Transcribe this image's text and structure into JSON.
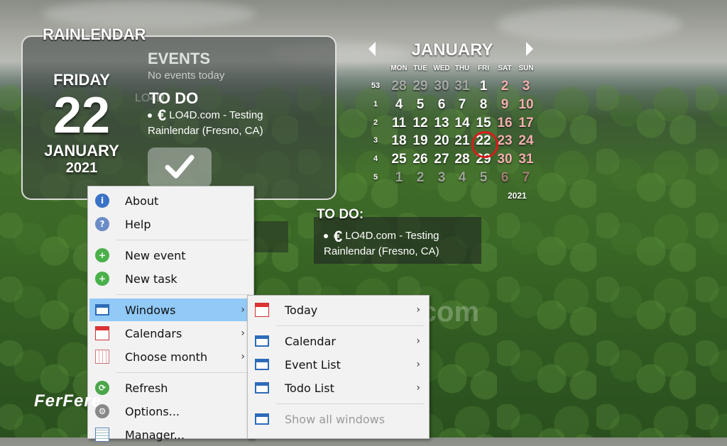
{
  "widget": {
    "title": "RAINLENDAR",
    "weekday": "FRIDAY",
    "day": "22",
    "month": "JANUARY",
    "year": "2021",
    "events_heading": "EVENTS",
    "events_empty": "No events today",
    "todo_heading": "TO DO",
    "todo_item": "LO4D.com - Testing Rainlendar (Fresno, CA)",
    "currency_glyph": "€",
    "watermark": "LO4D"
  },
  "calendar": {
    "month": "JANUARY",
    "year": "2021",
    "weekdays": [
      "MON",
      "TUE",
      "WED",
      "THU",
      "FRI",
      "SAT",
      "SUN"
    ],
    "weeks": [
      {
        "wk": "53",
        "days": [
          "28",
          "29",
          "30",
          "31",
          "1",
          "2",
          "3"
        ]
      },
      {
        "wk": "1",
        "days": [
          "4",
          "5",
          "6",
          "7",
          "8",
          "9",
          "10"
        ]
      },
      {
        "wk": "2",
        "days": [
          "11",
          "12",
          "13",
          "14",
          "15",
          "16",
          "17"
        ]
      },
      {
        "wk": "3",
        "days": [
          "18",
          "19",
          "20",
          "21",
          "22",
          "23",
          "24"
        ]
      },
      {
        "wk": "4",
        "days": [
          "25",
          "26",
          "27",
          "28",
          "29",
          "30",
          "31"
        ]
      },
      {
        "wk": "5",
        "days": [
          "1",
          "2",
          "3",
          "4",
          "5",
          "6",
          "7"
        ]
      }
    ],
    "today": "22",
    "weekend_color": "#f3b0b0",
    "today_ring_color": "#d81c1c"
  },
  "todo_widget": {
    "heading": "TO DO:",
    "item": "LO4D.com - Testing Rainlendar (Fresno, CA)",
    "currency_glyph": "€"
  },
  "menu_main": {
    "items": [
      {
        "label": "About",
        "icon": "info-icon"
      },
      {
        "label": "Help",
        "icon": "help-icon"
      },
      {
        "label": "New event",
        "icon": "plus-icon"
      },
      {
        "label": "New task",
        "icon": "plus-icon"
      },
      {
        "label": "Windows",
        "icon": "window-icon",
        "submenu": true,
        "highlighted": true
      },
      {
        "label": "Calendars",
        "icon": "calendar-icon",
        "submenu": true
      },
      {
        "label": "Choose month",
        "icon": "month-grid-icon",
        "submenu": true
      },
      {
        "label": "Refresh",
        "icon": "refresh-icon"
      },
      {
        "label": "Options...",
        "icon": "gear-icon"
      },
      {
        "label": "Manager...",
        "icon": "manager-icon"
      }
    ]
  },
  "menu_windows": {
    "items": [
      {
        "label": "Today",
        "icon": "calendar-icon",
        "submenu": true
      },
      {
        "label": "Calendar",
        "icon": "window-icon",
        "submenu": true
      },
      {
        "label": "Event List",
        "icon": "window-icon",
        "submenu": true
      },
      {
        "label": "Todo List",
        "icon": "window-icon",
        "submenu": true
      },
      {
        "label": "Show all windows",
        "icon": "window-icon",
        "disabled": true
      }
    ],
    "submenu_glyph": "›"
  },
  "watermarks": {
    "site": "LO4D.com",
    "brand": "FerFere"
  }
}
